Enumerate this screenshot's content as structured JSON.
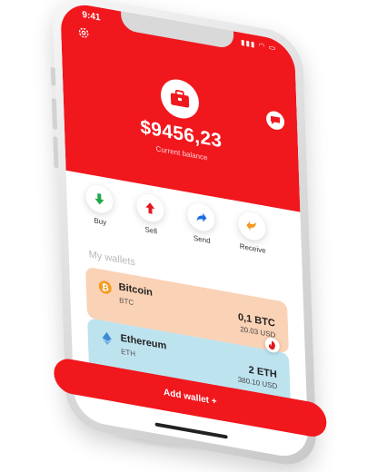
{
  "status": {
    "time": "9:41"
  },
  "balance": {
    "amount": "$9456,23",
    "label": "Current balance"
  },
  "actions": [
    {
      "label": "Buy",
      "icon": "arrow-down-icon",
      "color": "#1fa84a"
    },
    {
      "label": "Sell",
      "icon": "arrow-up-icon",
      "color": "#e3181e"
    },
    {
      "label": "Send",
      "icon": "arrow-send-icon",
      "color": "#1d6de5"
    },
    {
      "label": "Receive",
      "icon": "arrow-receive-icon",
      "color": "#f39a1f"
    }
  ],
  "wallets_title": "My wallets",
  "wallets": [
    {
      "name": "Bitcoin",
      "symbol": "BTC",
      "amount": "0,1 BTC",
      "usd": "20.03 USD",
      "color": "#fad2b5",
      "icon": "bitcoin-icon"
    },
    {
      "name": "Ethereum",
      "symbol": "ETH",
      "amount": "2 ETH",
      "usd": "380.10 USD",
      "color": "#bde3ef",
      "icon": "ethereum-icon"
    }
  ],
  "add_wallet": {
    "label": "Add wallet  +"
  },
  "colors": {
    "brand": "#f0171d"
  }
}
